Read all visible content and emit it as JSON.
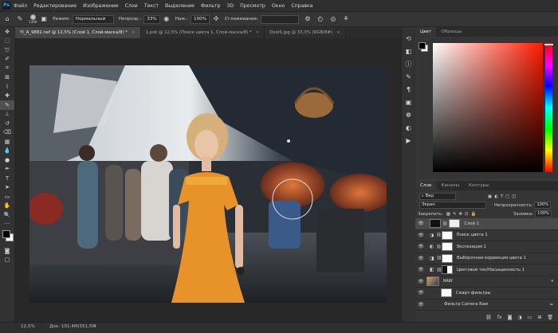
{
  "menu": [
    "Файл",
    "Редактирование",
    "Изображение",
    "Слои",
    "Текст",
    "Выделение",
    "Фильтр",
    "3D",
    "Просмотр",
    "Окно",
    "Справка"
  ],
  "options": {
    "brush_size": "1300",
    "mode_label": "Режим:",
    "mode_value": "Нормальный",
    "opacity_label": "Непрозр.:",
    "opacity_value": "33%",
    "pressure_label": "Наж.:",
    "pressure_value": "100%",
    "smoothing_label": "Сглаживание:"
  },
  "tabs": [
    {
      "label": "YI_A_9882.nef @ 12,5% (Слой 1, Слой-маска/8) *",
      "active": true
    },
    {
      "label": "1.psb @ 12,5% (Поиск цвета 1, Слой-маска/8) *",
      "active": false
    },
    {
      "label": "DoolS.jpg @ 33,3% (RGB/8#)",
      "active": false
    }
  ],
  "color_panel": {
    "tabs": [
      "Цвет",
      "Образцы"
    ],
    "foreground": "#000000",
    "background": "#ffffff",
    "hue_color": "#ff1a00"
  },
  "layers_panel": {
    "tabs": [
      "Слои",
      "Каналы",
      "Контуры"
    ],
    "filter_label": "Вид",
    "blend_mode": "Экран",
    "opacity_label": "Непрозрачность:",
    "opacity_value": "100%",
    "lock_label": "Закрепить:",
    "fill_label": "Заливка:",
    "fill_value": "100%",
    "layers": [
      {
        "name": "Слой 1",
        "selected": true
      },
      {
        "name": "Поиск цвета 1",
        "selected": false
      },
      {
        "name": "Экспозиция 1",
        "selected": false
      },
      {
        "name": "Выборочная коррекция цвета 1",
        "selected": false
      },
      {
        "name": "Цветовой тон/Насыщенность 1",
        "selected": false
      },
      {
        "name": "RAW",
        "selected": false
      },
      {
        "name": "Смарт-фильтры",
        "selected": false
      },
      {
        "name": "Фильтр Camera Raw",
        "selected": false
      }
    ]
  },
  "status": {
    "zoom": "12,5%",
    "doc": "Док: 101,4M/351,5M"
  }
}
